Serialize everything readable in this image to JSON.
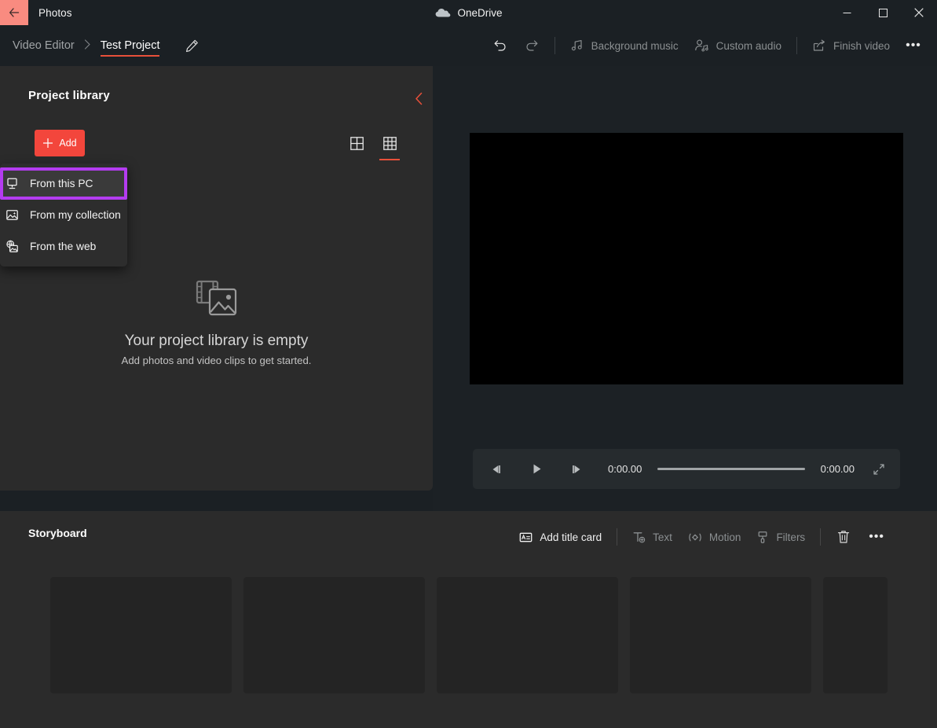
{
  "titlebar": {
    "back_icon": "back-arrow-icon",
    "app_name": "Photos",
    "onedrive_label": "OneDrive",
    "minimize": "—",
    "maximize": "□",
    "close": "✕"
  },
  "breadcrumb": {
    "root": "Video Editor",
    "separator": "›",
    "current": "Test Project",
    "edit_icon": "pencil-icon"
  },
  "commandbar": {
    "undo": "undo-icon",
    "redo": "redo-icon",
    "background_music": "Background music",
    "custom_audio": "Custom audio",
    "finish_video": "Finish video",
    "more": "•••"
  },
  "library": {
    "title": "Project library",
    "collapse_icon": "chevron-left-icon",
    "add_label": "Add",
    "view_large": "large-grid-icon",
    "view_small": "small-grid-icon",
    "selected_view": "small",
    "empty_title": "Your project library is empty",
    "empty_subtitle": "Add photos and video clips to get started."
  },
  "add_menu": {
    "items": [
      {
        "label": "From this PC",
        "icon": "monitor-icon",
        "focused": true
      },
      {
        "label": "From my collection",
        "icon": "photo-sparkle-icon",
        "focused": false
      },
      {
        "label": "From the web",
        "icon": "globe-photo-icon",
        "focused": false
      }
    ],
    "highlight_color": "#b43cf0"
  },
  "player": {
    "prev_frame": "previous-frame-icon",
    "play": "play-icon",
    "next_frame": "next-frame-icon",
    "current_time": "0:00.00",
    "total_time": "0:00.00",
    "fullscreen": "fullscreen-icon",
    "progress_percent": 0
  },
  "storyboard": {
    "title": "Storyboard",
    "add_title_card": "Add title card",
    "text": "Text",
    "motion": "Motion",
    "filters": "Filters",
    "delete": "trash-icon",
    "more": "•••",
    "cards": [
      {
        "id": "card-1"
      },
      {
        "id": "card-2"
      },
      {
        "id": "card-3"
      },
      {
        "id": "card-4"
      },
      {
        "id": "card-5"
      }
    ]
  },
  "colors": {
    "accent_red": "#f3463c",
    "highlight_purple": "#b43cf0",
    "panel_bg": "#2b2b2b",
    "chrome_bg": "#1b2024"
  }
}
